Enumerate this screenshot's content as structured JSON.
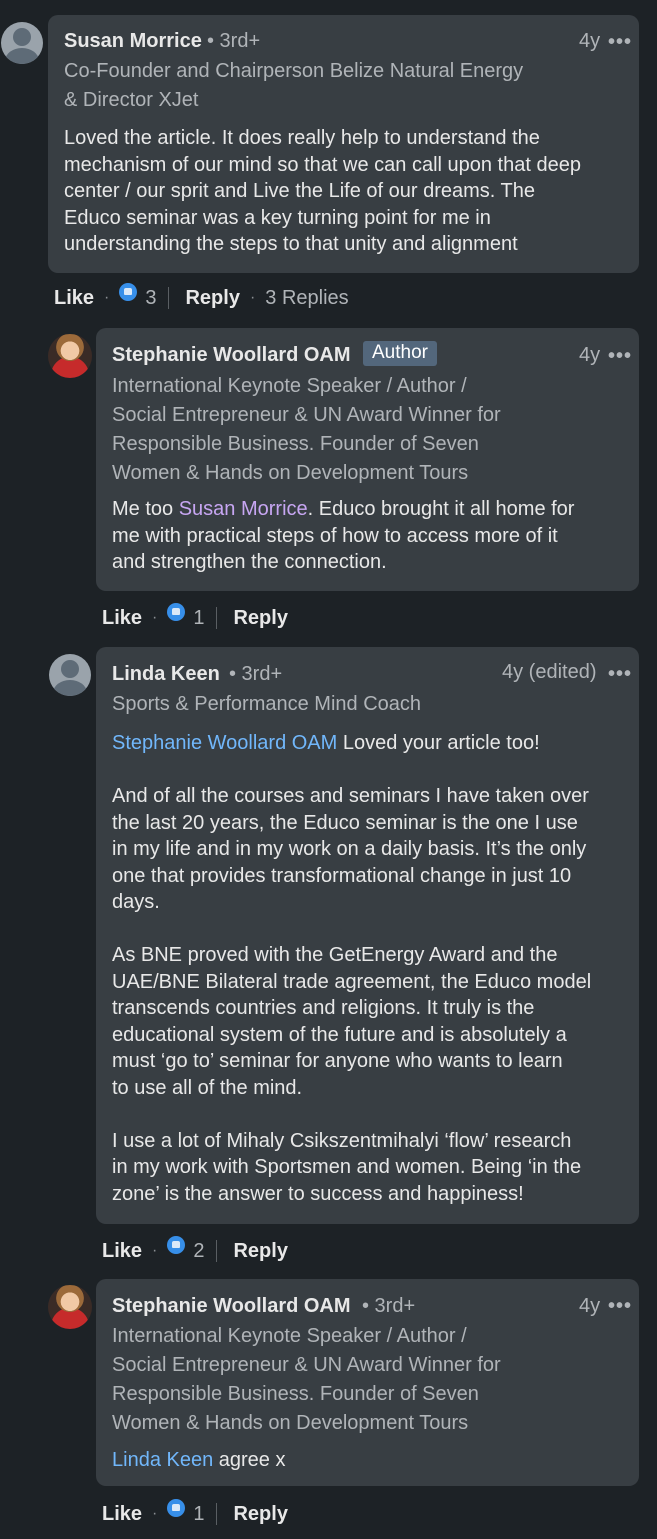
{
  "comments": [
    {
      "name": "Susan Morrice",
      "degree": "• 3rd+",
      "time": "4y",
      "headline_lines": [
        "Co-Founder and Chairperson Belize Natural Energy",
        "& Director XJet"
      ],
      "text": "Loved the article. It does really help to understand the\nmechanism of our mind so that we can call upon that deep\ncenter / our sprit and Live the Life of our dreams. The\nEduco seminar was a key turning point for me in\nunderstanding the steps to that unity and alignment",
      "actions": {
        "like": "Like",
        "reactions": "3",
        "reply": "Reply",
        "replies": "3 Replies"
      }
    },
    {
      "name": "Stephanie Woollard OAM",
      "badge": "Author",
      "time": "4y",
      "headline_lines": [
        "International Keynote Speaker / Author /",
        "Social Entrepreneur & UN Award Winner for",
        "Responsible Business. Founder of Seven",
        "Women & Hands on Development Tours"
      ],
      "mention": "Susan Morrice",
      "text": ". Educo brought it all home for\nme with practical steps of how to access more of it\nand strengthen the connection.",
      "text_prefix": "Me too ",
      "actions": {
        "like": "Like",
        "reactions": "1",
        "reply": "Reply"
      }
    },
    {
      "name": "Linda Keen",
      "degree": "• 3rd+",
      "time": "4y (edited)",
      "headline_lines": [
        "Sports & Performance Mind Coach"
      ],
      "mention": "Stephanie Woollard OAM",
      "text": " Loved your article too!\n\nAnd of all the courses and seminars I have taken over\nthe last 20 years, the Educo seminar is the one I use\nin my life and in my work on a daily basis. It’s the only\none that provides transformational change in just 10\ndays.\n\nAs BNE proved with the GetEnergy Award and the\nUAE/BNE Bilateral trade agreement, the Educo model\ntranscends countries and religions. It truly is the\neducational system of the future and is absolutely a\nmust ‘go to’ seminar for anyone who wants to learn\nto use all of the mind.\n\nI use a lot of Mihaly Csikszentmihalyi ‘flow’ research\nin my work with Sportsmen and women. Being ‘in the\nzone’ is the answer to success and happiness!",
      "actions": {
        "like": "Like",
        "reactions": "2",
        "reply": "Reply"
      }
    },
    {
      "name": "Stephanie Woollard OAM",
      "degree": "• 3rd+",
      "time": "4y",
      "headline_lines": [
        "International Keynote Speaker / Author /",
        "Social Entrepreneur & UN Award Winner for",
        "Responsible Business. Founder of Seven",
        "Women & Hands on Development Tours"
      ],
      "mention": "Linda Keen",
      "text": " agree x",
      "actions": {
        "like": "Like",
        "reactions": "1",
        "reply": "Reply"
      }
    }
  ],
  "more_icon": "•••",
  "colors": {
    "background": "#1d2226",
    "bubble": "#383e43",
    "mention_blue": "#71b7fb",
    "mention_purple": "#c7a6f2",
    "like_blue": "#378fe9"
  }
}
